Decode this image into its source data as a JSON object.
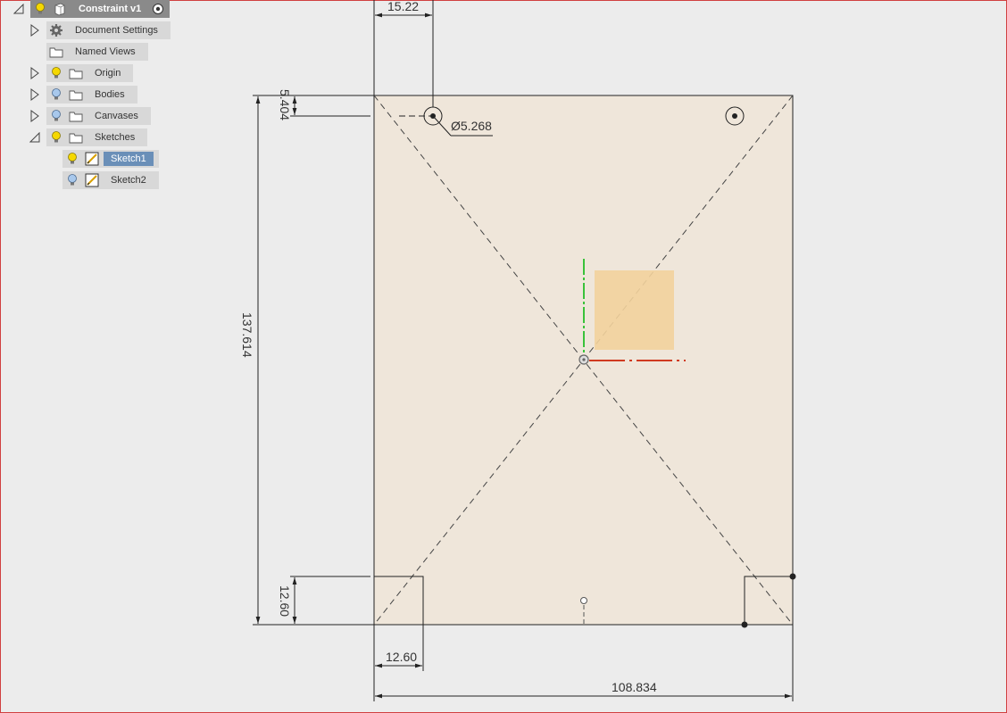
{
  "browser": {
    "root": {
      "label": "Constraint v1"
    },
    "items": [
      {
        "label": "Document Settings"
      },
      {
        "label": "Named Views"
      },
      {
        "label": "Origin"
      },
      {
        "label": "Bodies"
      },
      {
        "label": "Canvases"
      },
      {
        "label": "Sketches"
      }
    ],
    "sketches": [
      {
        "label": "Sketch1",
        "selected": true
      },
      {
        "label": "Sketch2",
        "selected": false
      }
    ]
  },
  "dimensions": {
    "hole_x": "15.22",
    "hole_y": "5.404",
    "hole_dia": "Ø5.268",
    "height": "137.614",
    "corner_h": "12.60",
    "corner_w": "12.60",
    "width": "108.834"
  },
  "colors": {
    "sheet_fill": "#efe6da",
    "selection_fill": "#f2d19c",
    "y_axis": "#3ac23a",
    "x_axis": "#d03a20",
    "highlight": "#6a8fb8"
  }
}
